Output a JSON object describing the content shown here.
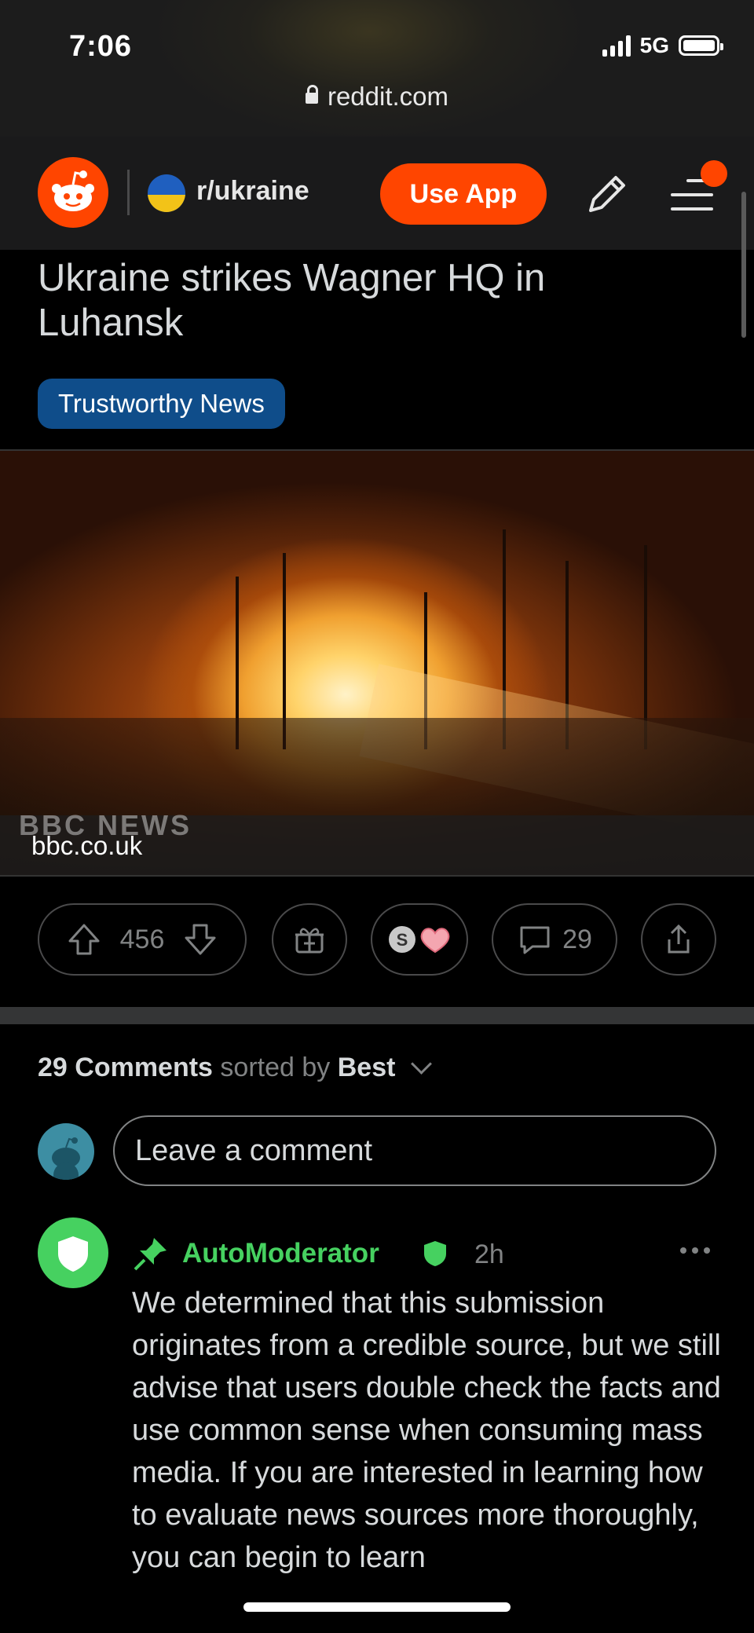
{
  "status_bar": {
    "time": "7:06",
    "network": "5G",
    "url": "reddit.com"
  },
  "nav": {
    "subreddit": "r/ukraine",
    "use_app_label": "Use App"
  },
  "post": {
    "title": "Ukraine strikes Wagner HQ in Luhansk",
    "flair": "Trustworthy News",
    "media_watermark": "BBC NEWS",
    "domain": "bbc.co.uk",
    "score": "456",
    "comments_count": "29"
  },
  "comments": {
    "count_label": "29 Comments",
    "sorted_by_label": "sorted by",
    "sort_value": "Best",
    "input_placeholder": "Leave a comment",
    "items": [
      {
        "author": "AutoModerator",
        "age": "2h",
        "body": "We determined that this submission originates from a credible source, but we still advise that users double check the facts and use common sense when consuming mass media. If you are interested in learning how to evaluate news sources more thoroughly, you can begin to learn"
      }
    ]
  },
  "colors": {
    "accent": "#ff4500",
    "flair": "#0f4d8a",
    "moderator": "#46d160",
    "background": "#000000"
  }
}
